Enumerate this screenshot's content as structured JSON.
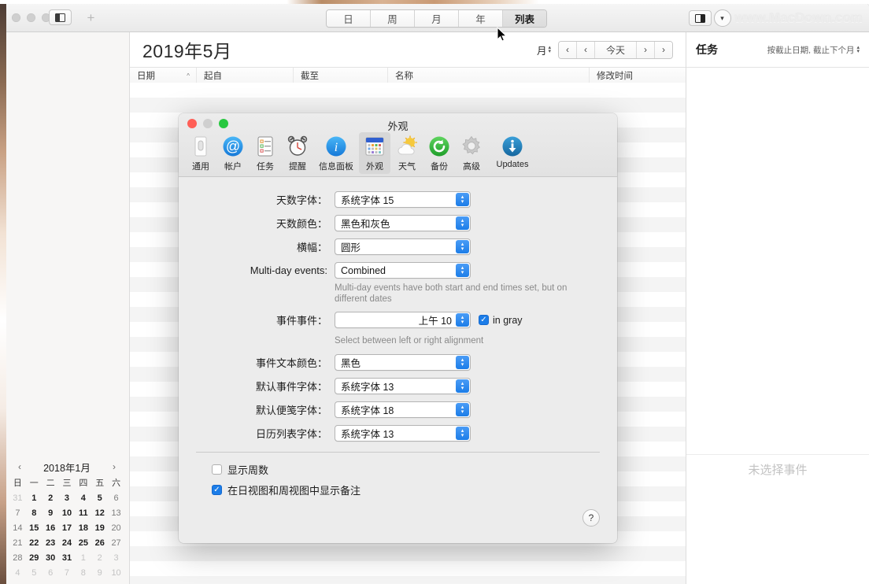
{
  "window": {
    "toolbar": {
      "sidebar_toggle_left_icon": "sidebar-left-icon",
      "add_label": "+",
      "view_segments": [
        {
          "label": "日",
          "active": false
        },
        {
          "label": "周",
          "active": false
        },
        {
          "label": "月",
          "active": false
        },
        {
          "label": "年",
          "active": false
        },
        {
          "label": "列表",
          "active": true
        }
      ],
      "sidebar_toggle_right_icon": "sidebar-right-icon",
      "chevron_down_icon": "chevron-down-icon",
      "watermark": "www.MacDown.com"
    }
  },
  "sidebar": {
    "mini_calendar": {
      "prev_label": "‹",
      "next_label": "›",
      "title": "2018年1月",
      "day_names": [
        "日",
        "一",
        "二",
        "三",
        "四",
        "五",
        "六"
      ],
      "weeks": [
        [
          {
            "d": "31",
            "t": "muted"
          },
          {
            "d": "1",
            "t": "day"
          },
          {
            "d": "2",
            "t": "day"
          },
          {
            "d": "3",
            "t": "day"
          },
          {
            "d": "4",
            "t": "day"
          },
          {
            "d": "5",
            "t": "day"
          },
          {
            "d": "6",
            "t": "wk"
          }
        ],
        [
          {
            "d": "7",
            "t": "wk"
          },
          {
            "d": "8",
            "t": "day"
          },
          {
            "d": "9",
            "t": "day"
          },
          {
            "d": "10",
            "t": "day"
          },
          {
            "d": "11",
            "t": "day"
          },
          {
            "d": "12",
            "t": "day"
          },
          {
            "d": "13",
            "t": "wk"
          }
        ],
        [
          {
            "d": "14",
            "t": "wk"
          },
          {
            "d": "15",
            "t": "day"
          },
          {
            "d": "16",
            "t": "day"
          },
          {
            "d": "17",
            "t": "day"
          },
          {
            "d": "18",
            "t": "day"
          },
          {
            "d": "19",
            "t": "day"
          },
          {
            "d": "20",
            "t": "wk"
          }
        ],
        [
          {
            "d": "21",
            "t": "wk"
          },
          {
            "d": "22",
            "t": "day"
          },
          {
            "d": "23",
            "t": "day"
          },
          {
            "d": "24",
            "t": "day"
          },
          {
            "d": "25",
            "t": "day"
          },
          {
            "d": "26",
            "t": "day"
          },
          {
            "d": "27",
            "t": "wk"
          }
        ],
        [
          {
            "d": "28",
            "t": "wk"
          },
          {
            "d": "29",
            "t": "day"
          },
          {
            "d": "30",
            "t": "day"
          },
          {
            "d": "31",
            "t": "day"
          },
          {
            "d": "1",
            "t": "muted"
          },
          {
            "d": "2",
            "t": "muted"
          },
          {
            "d": "3",
            "t": "muted"
          }
        ],
        [
          {
            "d": "4",
            "t": "muted"
          },
          {
            "d": "5",
            "t": "muted"
          },
          {
            "d": "6",
            "t": "muted"
          },
          {
            "d": "7",
            "t": "muted"
          },
          {
            "d": "8",
            "t": "muted"
          },
          {
            "d": "9",
            "t": "muted"
          },
          {
            "d": "10",
            "t": "muted"
          }
        ]
      ]
    }
  },
  "list_view": {
    "month_title": "2019年5月",
    "scale_label": "月",
    "nav": {
      "prev_fast": "‹",
      "prev": "‹",
      "today": "今天",
      "next": "›",
      "next_fast": "›"
    },
    "columns": [
      {
        "label": "日期",
        "sorted": true,
        "sort_caret": "^"
      },
      {
        "label": "起自",
        "sorted": false
      },
      {
        "label": "截至",
        "sorted": false
      },
      {
        "label": "名称",
        "sorted": false
      },
      {
        "label": "修改时间",
        "sorted": false
      }
    ]
  },
  "task_pane": {
    "title": "任务",
    "sort_label": "按截止日期, 截止下个月",
    "empty_text": "未选择事件"
  },
  "preferences": {
    "title": "外观",
    "tabs": [
      {
        "label": "通用",
        "icon": "general-icon",
        "active": false
      },
      {
        "label": "帐户",
        "icon": "at-sign-icon",
        "active": false
      },
      {
        "label": "任务",
        "icon": "checklist-icon",
        "active": false
      },
      {
        "label": "提醒",
        "icon": "alarm-clock-icon",
        "active": false
      },
      {
        "label": "信息面板",
        "icon": "info-icon",
        "active": false
      },
      {
        "label": "外观",
        "icon": "calendar-icon",
        "active": true
      },
      {
        "label": "天气",
        "icon": "weather-sun-cloud-icon",
        "active": false
      },
      {
        "label": "备份",
        "icon": "refresh-circle-icon",
        "active": false
      },
      {
        "label": "高级",
        "icon": "gear-icon",
        "active": false
      },
      {
        "label": "Updates",
        "icon": "download-arrow-icon",
        "active": false
      }
    ],
    "fields": [
      {
        "label": "天数字体：",
        "value": "系统字体 15",
        "name": "day-number-font"
      },
      {
        "label": "天数颜色：",
        "value": "黑色和灰色",
        "name": "day-number-color"
      },
      {
        "label": "横幅：",
        "value": "圆形",
        "name": "banner-shape"
      },
      {
        "label": "Multi-day events:",
        "value": "Combined",
        "name": "multi-day-events"
      }
    ],
    "multiday_helper": "Multi-day events have both start and end times set, but on different dates",
    "time_field": {
      "label": "事件事件：",
      "value": "上午 10",
      "checkbox_label": "in gray",
      "checkbox_checked": true
    },
    "alignment_helper": "Select between left or right alignment",
    "fields2": [
      {
        "label": "事件文本颜色：",
        "value": "黑色",
        "name": "event-text-color"
      },
      {
        "label": "默认事件字体：",
        "value": "系统字体 13",
        "name": "default-event-font"
      },
      {
        "label": "默认便笺字体：",
        "value": "系统字体 18",
        "name": "default-note-font"
      },
      {
        "label": "日历列表字体：",
        "value": "系统字体 13",
        "name": "calendar-list-font"
      }
    ],
    "checkboxes": [
      {
        "label": "显示周数",
        "checked": false,
        "name": "show-week-numbers"
      },
      {
        "label": "在日视图和周视图中显示备注",
        "checked": true,
        "name": "show-notes-in-day-week-view"
      }
    ],
    "help_label": "?"
  },
  "colors": {
    "accent_blue": "#1c7de8",
    "traffic_red": "#ff5f57",
    "traffic_green": "#28c840",
    "sheet_bg": "#ececec"
  }
}
